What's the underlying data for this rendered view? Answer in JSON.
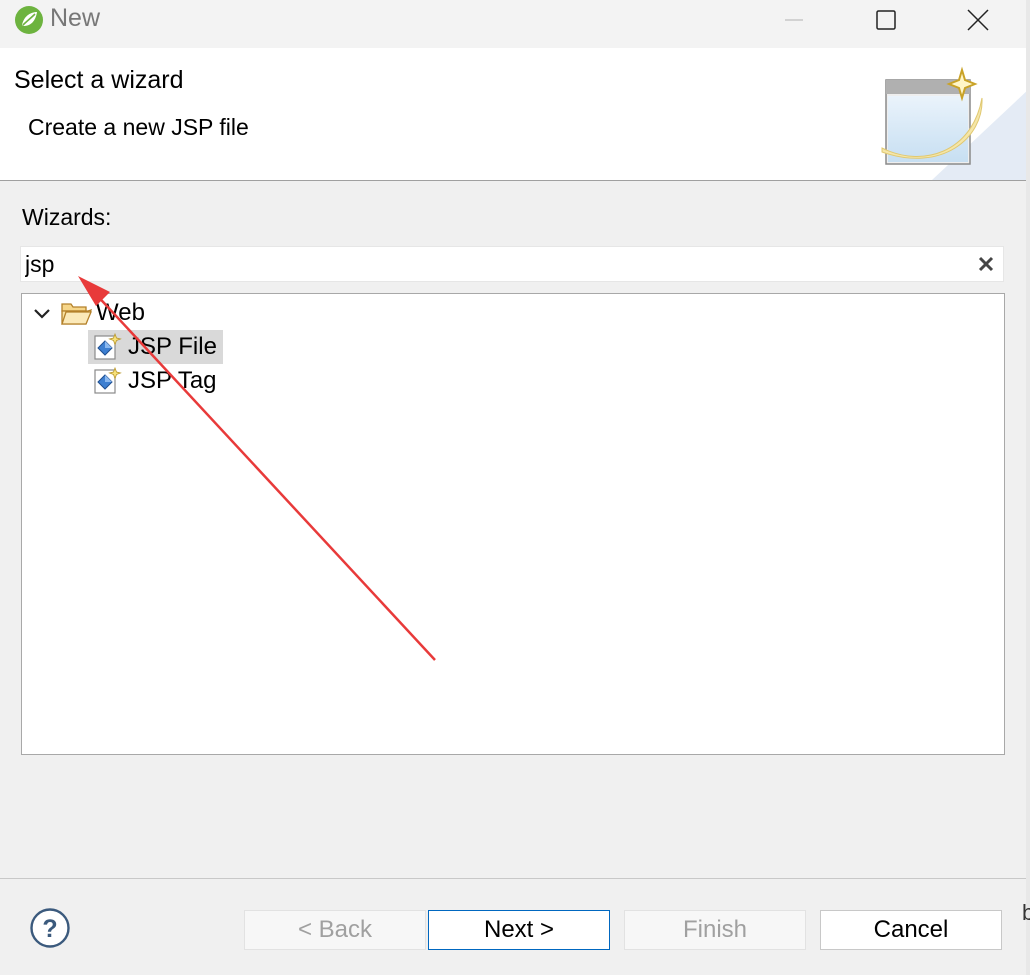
{
  "window": {
    "title": "New",
    "colors": {
      "accent": "#0067c0",
      "selection": "#d9d9d9",
      "arrow": "#e83a3a"
    }
  },
  "banner": {
    "title": "Select a wizard",
    "description": "Create a new JSP file"
  },
  "wizards": {
    "label": "Wizards:",
    "filter_value": "jsp"
  },
  "tree": {
    "items": [
      {
        "label": "Web",
        "icon": "folder-open-icon",
        "expanded": true
      },
      {
        "label": "JSP File",
        "icon": "jsp-file-icon",
        "selected": true
      },
      {
        "label": "JSP Tag",
        "icon": "jsp-tag-icon",
        "selected": false
      }
    ]
  },
  "buttons": {
    "back": "< Back",
    "next": "Next >",
    "finish": "Finish",
    "cancel": "Cancel"
  },
  "edge_text": "b"
}
